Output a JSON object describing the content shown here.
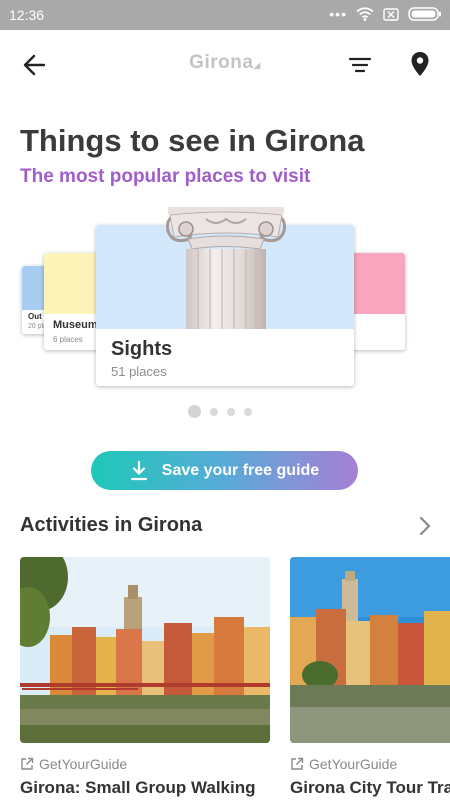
{
  "status_bar": {
    "time": "12:36",
    "icons": [
      "dots-icon",
      "wifi-icon",
      "sim-x-icon",
      "battery-icon"
    ]
  },
  "app_bar": {
    "logo_text": "Girona",
    "icons": {
      "back": "arrow-left-icon",
      "filter": "filter-icon",
      "location": "location-pin-icon"
    }
  },
  "header": {
    "title": "Things to see in Girona",
    "subtitle": "The most popular places to visit",
    "subtitle_color": "#a05fc8"
  },
  "carousel": {
    "cards": [
      {
        "name": "Out",
        "count": "20 pla",
        "image_color": "#a9cdf2"
      },
      {
        "name": "Museum",
        "count": "6 places",
        "image_color": "#fcf3b8"
      },
      {
        "name": "Sights",
        "count": "51 places",
        "image_color": "#d3e8fa"
      },
      {
        "name": "",
        "count": "",
        "image_color": "#f7a6bd"
      }
    ],
    "active_index": 0,
    "page_count": 4
  },
  "save_button": {
    "label": "Save your free guide",
    "gradient": [
      "#1ec8b8",
      "#58aad7",
      "#a77fd6"
    ]
  },
  "activities": {
    "title": "Activities in Girona",
    "items": [
      {
        "provider": "GetYourGuide",
        "title": "Girona: Small Group Walking"
      },
      {
        "provider": "GetYourGuide",
        "title": "Girona City Tour Tra"
      }
    ]
  }
}
